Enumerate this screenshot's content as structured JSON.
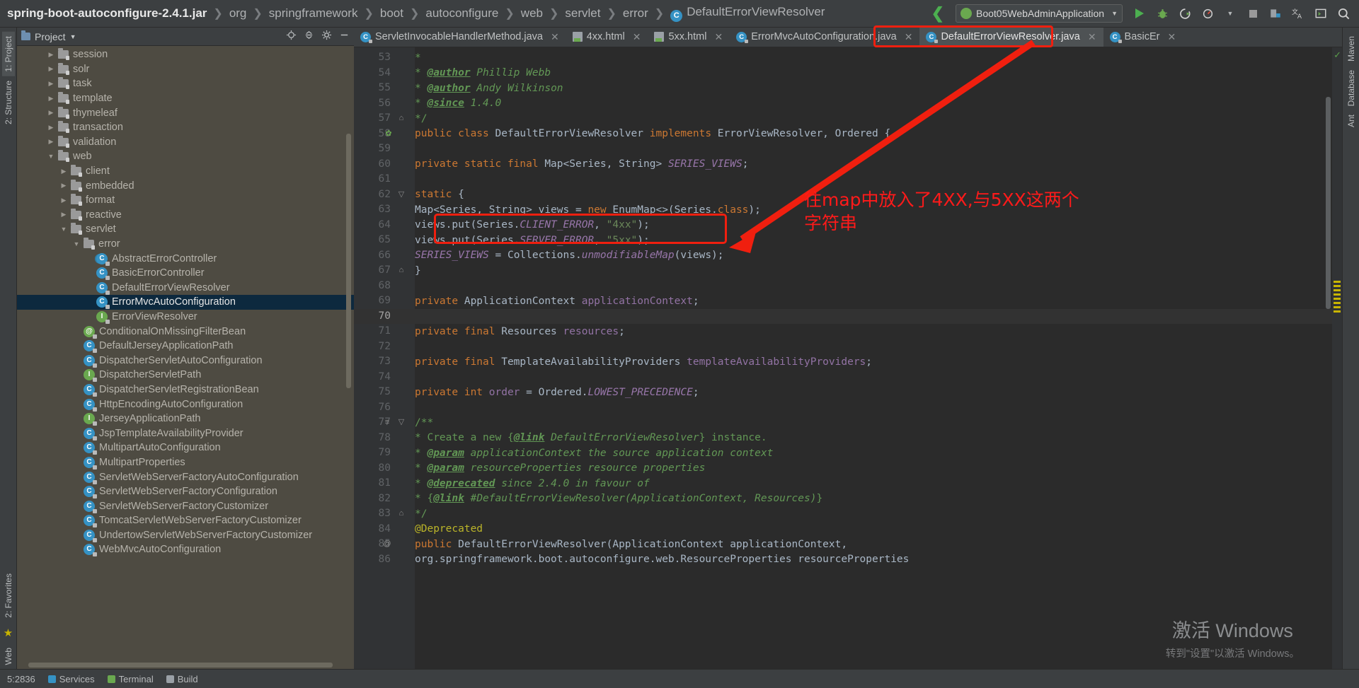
{
  "breadcrumb": {
    "items": [
      {
        "label": "spring-boot-autoconfigure-2.4.1.jar",
        "root": true
      },
      {
        "label": "org"
      },
      {
        "label": "springframework"
      },
      {
        "label": "boot"
      },
      {
        "label": "autoconfigure"
      },
      {
        "label": "web"
      },
      {
        "label": "servlet"
      },
      {
        "label": "error"
      },
      {
        "label": "DefaultErrorViewResolver",
        "icon": "class-icon"
      }
    ]
  },
  "toolbar": {
    "run_config": "Boot05WebAdminApplication",
    "icons": [
      "run-icon",
      "debug-icon",
      "run-coverage-icon",
      "profiler-icon",
      "stop-icon",
      "build-icon",
      "translate-icon",
      "terminal-icon",
      "search-everywhere-icon"
    ]
  },
  "project_panel": {
    "title": "Project",
    "tree": [
      {
        "label": "session",
        "type": "folder",
        "arrow": "right",
        "indent": 2
      },
      {
        "label": "solr",
        "type": "folder",
        "arrow": "right",
        "indent": 2
      },
      {
        "label": "task",
        "type": "folder",
        "arrow": "right",
        "indent": 2
      },
      {
        "label": "template",
        "type": "folder",
        "arrow": "right",
        "indent": 2
      },
      {
        "label": "thymeleaf",
        "type": "folder",
        "arrow": "right",
        "indent": 2
      },
      {
        "label": "transaction",
        "type": "folder",
        "arrow": "right",
        "indent": 2
      },
      {
        "label": "validation",
        "type": "folder",
        "arrow": "right",
        "indent": 2
      },
      {
        "label": "web",
        "type": "folder",
        "arrow": "down",
        "indent": 2
      },
      {
        "label": "client",
        "type": "folder",
        "arrow": "right",
        "indent": 3
      },
      {
        "label": "embedded",
        "type": "folder",
        "arrow": "right",
        "indent": 3
      },
      {
        "label": "format",
        "type": "folder",
        "arrow": "right",
        "indent": 3
      },
      {
        "label": "reactive",
        "type": "folder",
        "arrow": "right",
        "indent": 3
      },
      {
        "label": "servlet",
        "type": "folder",
        "arrow": "down",
        "indent": 3
      },
      {
        "label": "error",
        "type": "folder",
        "arrow": "down",
        "indent": 4
      },
      {
        "label": "AbstractErrorController",
        "type": "abstract-class",
        "indent": 5
      },
      {
        "label": "BasicErrorController",
        "type": "class",
        "indent": 5
      },
      {
        "label": "DefaultErrorViewResolver",
        "type": "class",
        "indent": 5
      },
      {
        "label": "ErrorMvcAutoConfiguration",
        "type": "class",
        "indent": 5,
        "selected": true
      },
      {
        "label": "ErrorViewResolver",
        "type": "interface",
        "indent": 5
      },
      {
        "label": "ConditionalOnMissingFilterBean",
        "type": "annotation",
        "indent": 4
      },
      {
        "label": "DefaultJerseyApplicationPath",
        "type": "class",
        "indent": 4
      },
      {
        "label": "DispatcherServletAutoConfiguration",
        "type": "class",
        "indent": 4
      },
      {
        "label": "DispatcherServletPath",
        "type": "interface",
        "indent": 4
      },
      {
        "label": "DispatcherServletRegistrationBean",
        "type": "class",
        "indent": 4
      },
      {
        "label": "HttpEncodingAutoConfiguration",
        "type": "class",
        "indent": 4
      },
      {
        "label": "JerseyApplicationPath",
        "type": "interface",
        "indent": 4
      },
      {
        "label": "JspTemplateAvailabilityProvider",
        "type": "class",
        "indent": 4
      },
      {
        "label": "MultipartAutoConfiguration",
        "type": "class",
        "indent": 4
      },
      {
        "label": "MultipartProperties",
        "type": "class",
        "indent": 4
      },
      {
        "label": "ServletWebServerFactoryAutoConfiguration",
        "type": "class",
        "indent": 4
      },
      {
        "label": "ServletWebServerFactoryConfiguration",
        "type": "class",
        "indent": 4
      },
      {
        "label": "ServletWebServerFactoryCustomizer",
        "type": "class",
        "indent": 4
      },
      {
        "label": "TomcatServletWebServerFactoryCustomizer",
        "type": "class",
        "indent": 4
      },
      {
        "label": "UndertowServletWebServerFactoryCustomizer",
        "type": "class",
        "indent": 4
      },
      {
        "label": "WebMvcAutoConfiguration",
        "type": "class",
        "indent": 4
      }
    ]
  },
  "left_strip": {
    "tabs": [
      "1: Project",
      "2: Structure",
      "2: Favorites",
      "Web"
    ]
  },
  "right_strip": {
    "tabs": [
      "Maven",
      "Database",
      "Ant"
    ]
  },
  "editor_tabs": [
    {
      "label": "ServletInvocableHandlerMethod.java",
      "icon": "class-icon",
      "active": false
    },
    {
      "label": "4xx.html",
      "icon": "html-icon",
      "active": false
    },
    {
      "label": "5xx.html",
      "icon": "html-icon",
      "active": false
    },
    {
      "label": "ErrorMvcAutoConfiguration.java",
      "icon": "class-icon",
      "active": false
    },
    {
      "label": "DefaultErrorViewResolver.java",
      "icon": "class-icon",
      "active": true,
      "highlighted": true
    },
    {
      "label": "BasicEr",
      "icon": "class-icon",
      "active": false
    }
  ],
  "editor": {
    "first_line": 53,
    "current_line": 70,
    "lines": [
      {
        "n": 53,
        "html": "     <span class='doc'>*</span>"
      },
      {
        "n": 54,
        "html": "     <span class='doc'>* </span><span class='tag'>@author</span><span class='doc italic'> Phillip Webb</span>"
      },
      {
        "n": 55,
        "html": "     <span class='doc'>* </span><span class='tag'>@author</span><span class='doc italic'> Andy Wilkinson</span>"
      },
      {
        "n": 56,
        "html": "     <span class='doc'>* </span><span class='tag'>@since</span><span class='doc italic'> 1.4.0</span>"
      },
      {
        "n": 57,
        "html": "     <span class='doc'>*/</span>",
        "fold": "end"
      },
      {
        "n": 58,
        "html": "<span class='kw'>public class </span><span class='cls'>DefaultErrorViewResolver </span><span class='kw'>implements </span><span class='cls'>ErrorViewResolver, Ordered </span><span class='ident'>{</span>",
        "bean": true
      },
      {
        "n": 59,
        "html": ""
      },
      {
        "n": 60,
        "html": "    <span class='kw'>private static final </span><span class='cls'>Map&lt;Series, String&gt; </span><span class='stat'>SERIES_VIEWS</span><span class='ident'>;</span>"
      },
      {
        "n": 61,
        "html": ""
      },
      {
        "n": 62,
        "html": "    <span class='kw'>static </span><span class='ident'>{</span>",
        "fold": "start"
      },
      {
        "n": 63,
        "html": "        <span class='cls'>Map&lt;Series, String&gt; views = </span><span class='kw'>new </span><span class='cls'>EnumMap&lt;&gt;(Series.</span><span class='kw'>class</span><span class='cls'>);</span>"
      },
      {
        "n": 64,
        "html": "        <span class='cls'>views.put(Series.</span><span class='stat'>CLIENT_ERROR</span><span class='cls'>, </span><span class='str'>\"4xx\"</span><span class='cls'>);</span>"
      },
      {
        "n": 65,
        "html": "        <span class='cls'>views.put(Series.</span><span class='stat'>SERVER_ERROR</span><span class='cls'>, </span><span class='str'>\"5xx\"</span><span class='cls'>);</span>"
      },
      {
        "n": 66,
        "html": "        <span class='stat'>SERIES_VIEWS </span><span class='cls'>= Collections.</span><span class='stat'>unmodifiableMap</span><span class='cls'>(views);</span>"
      },
      {
        "n": 67,
        "html": "    <span class='ident'>}</span>",
        "fold": "end"
      },
      {
        "n": 68,
        "html": ""
      },
      {
        "n": 69,
        "html": "    <span class='kw'>private </span><span class='cls'>ApplicationContext </span><span class='fld'>applicationContext</span><span class='ident'>;</span>"
      },
      {
        "n": 70,
        "html": "",
        "current": true
      },
      {
        "n": 71,
        "html": "    <span class='kw'>private final </span><span class='cls'>Resources </span><span class='fld'>resources</span><span class='ident'>;</span>"
      },
      {
        "n": 72,
        "html": ""
      },
      {
        "n": 73,
        "html": "    <span class='kw'>private final </span><span class='cls'>TemplateAvailabilityProviders </span><span class='fld'>templateAvailabilityProviders</span><span class='ident'>;</span>"
      },
      {
        "n": 74,
        "html": ""
      },
      {
        "n": 75,
        "html": "    <span class='kw'>private int </span><span class='fld'>order </span><span class='cls'>= Ordered.</span><span class='stat'>LOWEST_PRECEDENCE</span><span class='ident'>;</span>"
      },
      {
        "n": 76,
        "html": ""
      },
      {
        "n": 77,
        "html": "    <span class='doc'>/**</span>",
        "fold": "start",
        "doctag": true
      },
      {
        "n": 78,
        "html": "     <span class='doc'>* Create a new {</span><span class='tag'>@link</span><span class='doc italic'> DefaultErrorViewResolver</span><span class='doc'>} instance.</span>"
      },
      {
        "n": 79,
        "html": "     <span class='doc'>* </span><span class='tag'>@param</span><span class='doc italic'> applicationContext the source application context</span>"
      },
      {
        "n": 80,
        "html": "     <span class='doc'>* </span><span class='tag'>@param</span><span class='doc italic'> resourceProperties resource properties</span>"
      },
      {
        "n": 81,
        "html": "     <span class='doc'>* </span><span class='tag'>@deprecated</span><span class='doc italic'> since 2.4.0 in favour of</span>"
      },
      {
        "n": 82,
        "html": "     <span class='doc'>* {</span><span class='tag'>@link</span><span class='doc italic'> #DefaultErrorViewResolver(ApplicationContext, Resources)</span><span class='doc'>}</span>"
      },
      {
        "n": 83,
        "html": "     <span class='doc'>*/</span>",
        "fold": "end"
      },
      {
        "n": 84,
        "html": "    <span class='anno'>@Deprecated</span>"
      },
      {
        "n": 85,
        "html": "    <span class='kw'>public </span><span class='cls'>DefaultErrorViewResolver(ApplicationContext applicationContext,</span>",
        "at": true
      },
      {
        "n": 86,
        "html": "            <span class='cls'>org.springframework.boot.autoconfigure.web.ResourceProperties resourceProperties</span>"
      }
    ]
  },
  "annotation": {
    "text_line1": "往map中放入了4XX,与5XX这两个",
    "text_line2": "字符串",
    "color": "#ff1a1a"
  },
  "watermark": {
    "line1": "激活 Windows",
    "line2": "转到\"设置\"以激活 Windows。"
  },
  "status_bar": {
    "items": [
      "5:2836",
      "Services",
      "Terminal",
      "Build"
    ]
  }
}
